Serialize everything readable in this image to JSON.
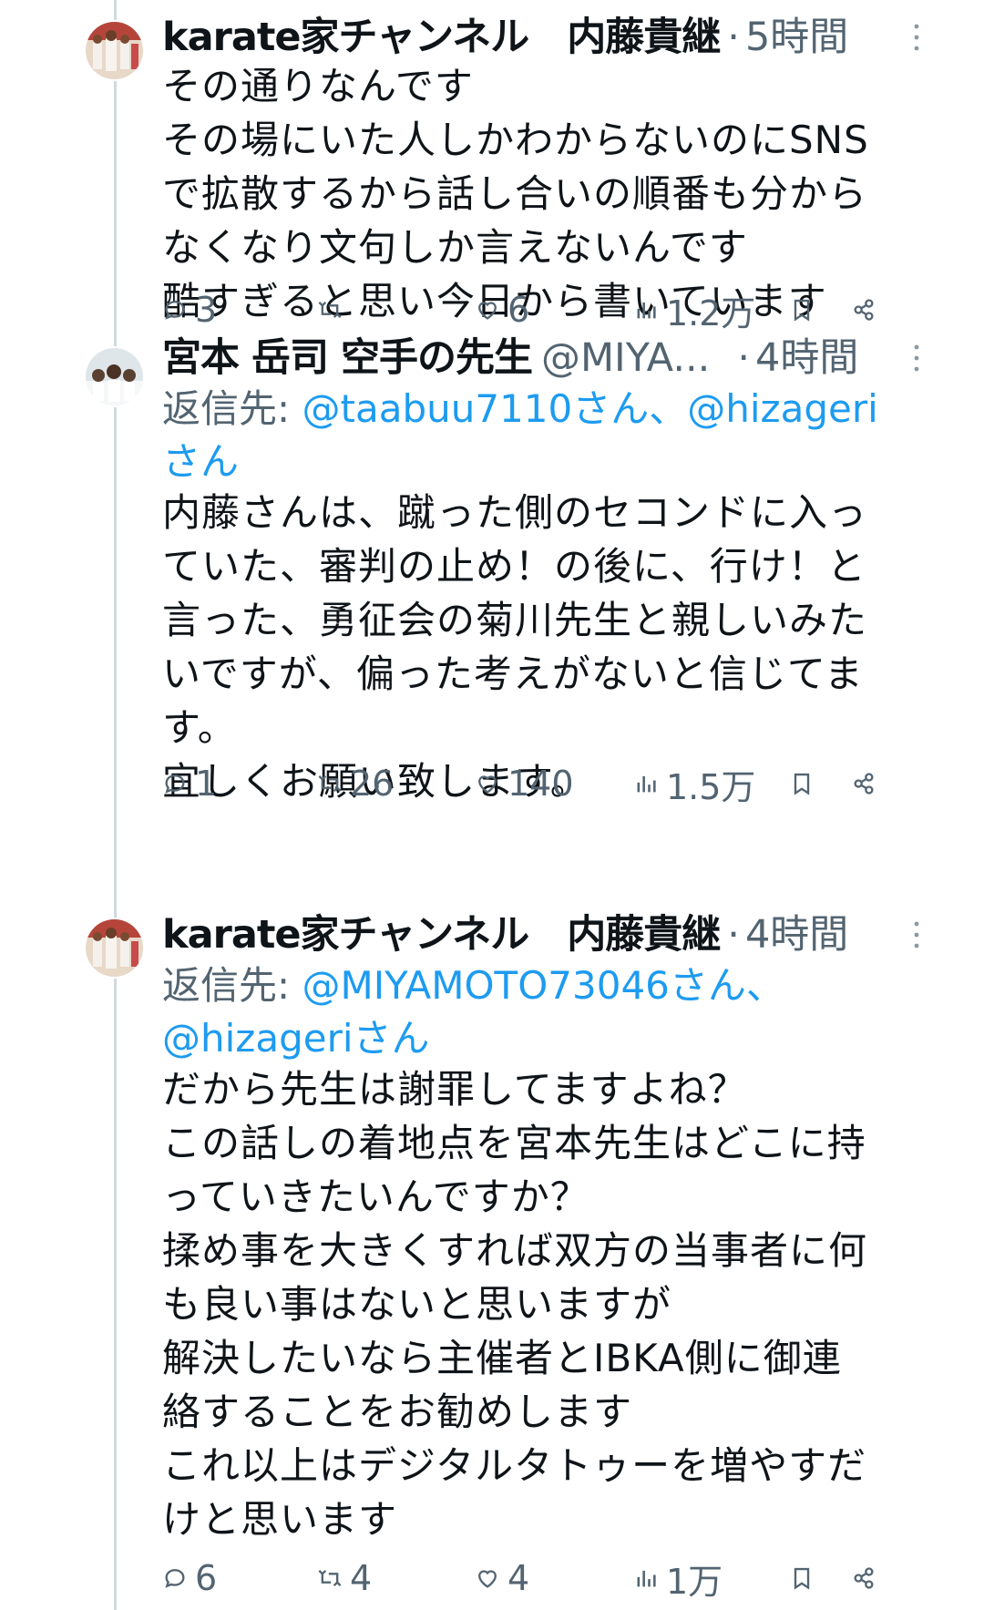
{
  "tweets": [
    {
      "display_name": "karate家チャンネル　内藤貴継",
      "handle": "",
      "separator": "·",
      "time": "5時間",
      "reply_prefix": "",
      "reply_mentions": "",
      "text": "その通りなんです\nその場にいた人しかわからないのにSNS\nで拡散するから話し合いの順番も分から\nなくなり文句しか言えないんです\n酷すぎると思い今日から書いています",
      "stats": {
        "replies": "3",
        "retweets": "",
        "likes": "6",
        "views": "1.2万"
      }
    },
    {
      "display_name": "宮本 岳司 空手の先生",
      "handle": "@MIYA...",
      "separator": "·",
      "time": "4時間",
      "reply_prefix": "返信先: ",
      "reply_mentions": "@taabuu7110さん、@hizageri\nさん",
      "text": "内藤さんは、蹴った側のセコンドに入っ\nていた、審判の止め！の後に、行け！と\n言った、勇征会の菊川先生と親しいみた\nいですが、偏った考えがないと信じてま\nす。\n宜しくお願い致します。",
      "stats": {
        "replies": "1",
        "retweets": "26",
        "likes": "140",
        "views": "1.5万"
      }
    },
    {
      "display_name": "karate家チャンネル　内藤貴継",
      "handle": "",
      "separator": "·",
      "time": "4時間",
      "reply_prefix": "返信先: ",
      "reply_mentions": "@MIYAMOTO73046さん、\n@hizageriさん",
      "text": "だから先生は謝罪してますよね？\nこの話しの着地点を宮本先生はどこに持\nっていきたいんですか？\n揉め事を大きくすれば双方の当事者に何\nも良い事はないと思いますが\n解決したいなら主催者とIBKA側に御連\n絡することをお勧めします\nこれ以上はデジタルタトゥーを増やすだ\nけと思います",
      "stats": {
        "replies": "6",
        "retweets": "4",
        "likes": "4",
        "views": "1万"
      }
    }
  ],
  "icons": {
    "reply": "reply-icon",
    "retweet": "retweet-icon",
    "like": "heart-icon",
    "views": "views-icon",
    "bookmark": "bookmark-icon",
    "share": "share-icon",
    "more": "more-icon"
  },
  "colors": {
    "text": "#0f1419",
    "secondary": "#536471",
    "link": "#1d9bf0",
    "thread_line": "#cfd9de"
  }
}
